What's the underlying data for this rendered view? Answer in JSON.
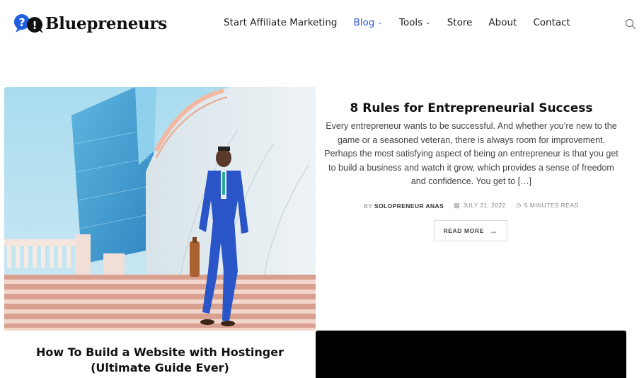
{
  "site": {
    "name": "Bluepreneurs"
  },
  "nav": {
    "items": [
      {
        "label": "Start Affiliate Marketing",
        "dropdown": false,
        "active": false
      },
      {
        "label": "Blog",
        "dropdown": true,
        "active": true
      },
      {
        "label": "Tools",
        "dropdown": true,
        "active": false
      },
      {
        "label": "Store",
        "dropdown": false,
        "active": false
      },
      {
        "label": "About",
        "dropdown": false,
        "active": false
      },
      {
        "label": "Contact",
        "dropdown": false,
        "active": false
      }
    ],
    "chevron": "⌄",
    "search_icon": "search-icon"
  },
  "featured": {
    "title": "8 Rules for Entrepreneurial Success",
    "excerpt": "Every entrepreneur wants to be successful. And whether you’re new to the game or a seasoned veteran, there is always room for improvement. Perhaps the most satisfying aspect of being an entrepreneur is that you get to build a business and watch it grow, which provides a sense of freedom and confidence. You get to […]",
    "by_prefix": "BY",
    "author": "SOLOPRENEUR ANAS",
    "date": "JULY 21, 2022",
    "read_time": "5 MINUTES READ",
    "read_more": "READ MORE"
  },
  "second_post": {
    "title": "How To Build a Website with Hostinger (Ultimate Guide Ever)"
  },
  "colors": {
    "accent": "#2f5ad6",
    "logo_blue": "#1f5fe0",
    "text": "#222222"
  }
}
